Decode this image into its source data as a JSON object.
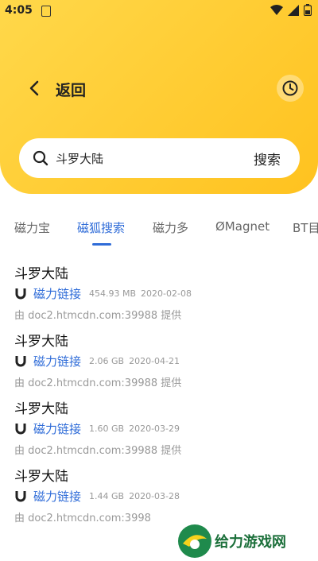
{
  "status_bar": {
    "time": "4:05"
  },
  "header": {
    "back_label": "返回"
  },
  "search": {
    "query": "斗罗大陆",
    "button_label": "搜索"
  },
  "tabs": [
    "磁力宝",
    "磁狐搜索",
    "磁力多",
    "ØMagnet",
    "BT目"
  ],
  "active_tab": "磁狐搜索",
  "results": [
    {
      "title": "斗罗大陆",
      "link_label": "磁力链接",
      "size": "454.93 MB",
      "date": "2020-02-08",
      "source": "由 doc2.htmcdn.com:39988 提供"
    },
    {
      "title": "斗罗大陆",
      "link_label": "磁力链接",
      "size": "2.06 GB",
      "date": "2020-04-21",
      "source": "由 doc2.htmcdn.com:39988 提供"
    },
    {
      "title": "斗罗大陆",
      "link_label": "磁力链接",
      "size": "1.60 GB",
      "date": "2020-03-29",
      "source": "由 doc2.htmcdn.com:39988 提供"
    },
    {
      "title": "斗罗大陆",
      "link_label": "磁力链接",
      "size": "1.44 GB",
      "date": "2020-03-28",
      "source": "由 doc2.htmcdn.com:3998"
    }
  ],
  "watermark": {
    "text": "给力游戏网"
  },
  "colors": {
    "header": "#ffc21f",
    "accent": "#2f6cd8"
  }
}
